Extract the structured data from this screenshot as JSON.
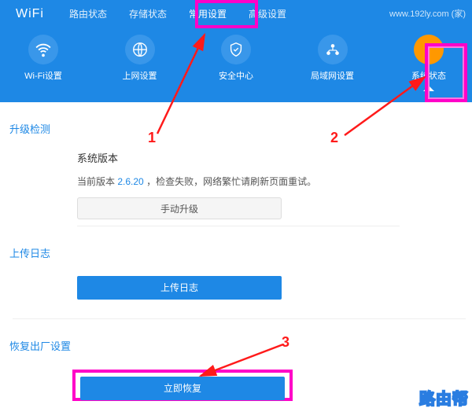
{
  "logo": "WiFi",
  "top_url": "www.192ly.com (家)",
  "tabs": {
    "router_status": "路由状态",
    "storage_status": "存储状态",
    "common_settings": "常用设置",
    "advanced_settings": "高级设置"
  },
  "nav": {
    "wifi": "Wi-Fi设置",
    "internet": "上网设置",
    "security": "安全中心",
    "lan": "局域网设置",
    "system": "系统状态"
  },
  "sections": {
    "upgrade_check": "升级检测",
    "system_version": "系统版本",
    "version_line_prefix": "当前版本",
    "version": "2.6.20",
    "version_line_suffix": "，检查失败，网络繁忙请刷新页面重试。",
    "manual_upgrade": "手动升级",
    "upload_log": "上传日志",
    "upload_log_btn": "上传日志",
    "factory_reset": "恢复出厂设置",
    "restore_now": "立即恢复"
  },
  "annotations": {
    "n1": "1",
    "n2": "2",
    "n3": "3"
  },
  "watermark": "路由帮"
}
